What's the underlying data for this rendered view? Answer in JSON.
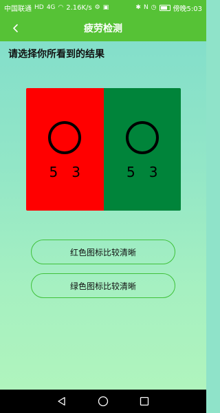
{
  "status_bar": {
    "carrier": "中国联通",
    "network": "HD",
    "signal": "4G",
    "speed": "2.16K/s",
    "time_label": "傍晚5:03"
  },
  "header": {
    "title": "疲劳检测",
    "back_icon": "chevron-left-icon",
    "background_color": "#56c236"
  },
  "prompt": "请选择你所看到的结果",
  "test_card": {
    "left": {
      "color": "#ff0000",
      "digit_1": "5",
      "digit_2": "3"
    },
    "right": {
      "color": "#00843a",
      "digit_1": "5",
      "digit_2": "3"
    }
  },
  "choices": {
    "red_label": "红色图标比较清晰",
    "green_label": "绿色图标比较清晰"
  },
  "nav_bar": {
    "back_icon": "triangle-back-icon",
    "home_icon": "circle-home-icon",
    "recents_icon": "square-recents-icon"
  }
}
